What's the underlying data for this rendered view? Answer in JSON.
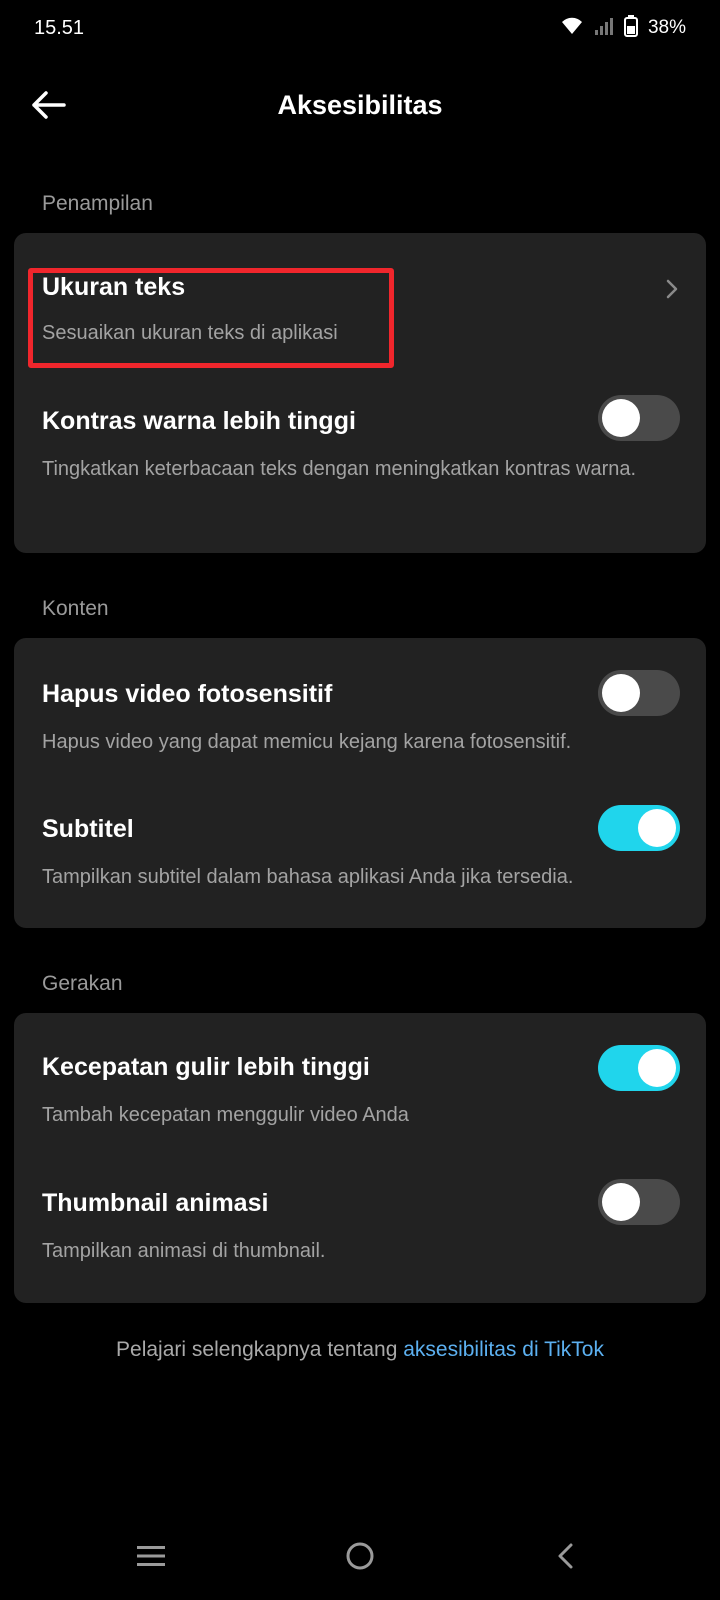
{
  "status_bar": {
    "time": "15.51",
    "battery": "38%"
  },
  "header": {
    "title": "Aksesibilitas"
  },
  "sections": {
    "display": {
      "label": "Penampilan",
      "text_size": {
        "title": "Ukuran teks",
        "subtitle": "Sesuaikan ukuran teks di aplikasi"
      },
      "contrast": {
        "title": "Kontras warna lebih tinggi",
        "subtitle": "Tingkatkan keterbacaan teks dengan meningkatkan kontras warna.",
        "enabled": false
      }
    },
    "content": {
      "label": "Konten",
      "photosensitive": {
        "title": "Hapus video fotosensitif",
        "subtitle": "Hapus video yang dapat memicu kejang karena fotosensitif.",
        "enabled": false
      },
      "subtitles": {
        "title": "Subtitel",
        "subtitle": "Tampilkan subtitel dalam bahasa aplikasi Anda jika tersedia.",
        "enabled": true
      }
    },
    "motion": {
      "label": "Gerakan",
      "scroll_speed": {
        "title": "Kecepatan gulir lebih tinggi",
        "subtitle": "Tambah kecepatan menggulir video Anda",
        "enabled": true
      },
      "animated_thumbnail": {
        "title": "Thumbnail animasi",
        "subtitle": "Tampilkan animasi di thumbnail.",
        "enabled": false
      }
    }
  },
  "footer": {
    "prefix": "Pelajari selengkapnya tentang ",
    "link": "aksesibilitas di TikTok"
  },
  "colors": {
    "background": "#000000",
    "card": "#222222",
    "toggle_on": "#20d5ec",
    "toggle_off": "#4a4a4a",
    "link": "#5cb0f0",
    "highlight": "#f0262c"
  },
  "icons": {
    "back": "arrow-left-icon",
    "chevron": "chevron-right-icon",
    "wifi": "wifi-icon",
    "signal": "signal-icon",
    "battery": "battery-icon",
    "nav_menu": "menu-icon",
    "nav_home": "home-circle-icon",
    "nav_back": "nav-back-icon"
  }
}
